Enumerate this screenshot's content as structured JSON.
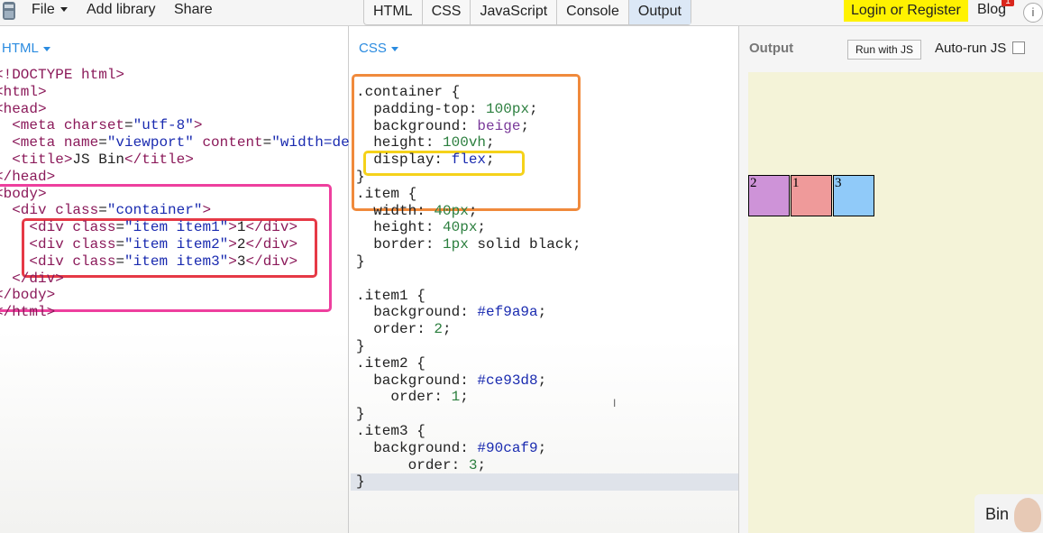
{
  "menu": {
    "file": "File",
    "add_library": "Add library",
    "share": "Share"
  },
  "tabs": [
    "HTML",
    "CSS",
    "JavaScript",
    "Console",
    "Output"
  ],
  "active_tab": "Output",
  "account": {
    "login": "Login or Register",
    "blog": "Blog",
    "badge": "1",
    "info": "i"
  },
  "html_panel": {
    "label": "HTML"
  },
  "css_panel": {
    "label": "CSS"
  },
  "output_panel": {
    "label": "Output",
    "run_button": "Run with JS",
    "autorun": "Auto-run JS",
    "autorun_checked": false
  },
  "html_code": {
    "l1": "<!DOCTYPE html>",
    "l2": "<html>",
    "l3": "<head>",
    "l4a": "  <meta ",
    "l4b": "charset",
    "l4c": "=",
    "l4d": "\"utf-8\"",
    "l4e": ">",
    "l5a": "  <meta ",
    "l5b": "name",
    "l5c": "=",
    "l5d": "\"viewport\"",
    "l5e": " content",
    "l5f": "=",
    "l5g": "\"width=de",
    "l6a": "  <title>",
    "l6b": "JS Bin",
    "l6c": "</title>",
    "l7": "</head>",
    "l8": "<body>",
    "l9a": "  <div ",
    "l9b": "class",
    "l9c": "=",
    "l9d": "\"container\"",
    "l9e": ">",
    "l10a": "    <div ",
    "l10b": "class",
    "l10c": "=",
    "l10d": "\"item item1\"",
    "l10e": ">",
    "l10f": "1",
    "l10g": "</div>",
    "l11a": "    <div ",
    "l11b": "class",
    "l11c": "=",
    "l11d": "\"item item2\"",
    "l11e": ">",
    "l11f": "2",
    "l11g": "</div>",
    "l12a": "    <div ",
    "l12b": "class",
    "l12c": "=",
    "l12d": "\"item item3\"",
    "l12e": ">",
    "l12f": "3",
    "l12g": "</div>",
    "l13": "  </div>",
    "l14": "</body>",
    "l15": "</html>"
  },
  "css_code": {
    "c1": ".container {",
    "c2a": "  padding-top: ",
    "c2b": "100px",
    "c2c": ";",
    "c3a": "  background: ",
    "c3b": "beige",
    "c3c": ";",
    "c4a": "  height: ",
    "c4b": "100vh",
    "c4c": ";",
    "c5a": "  display: ",
    "c5b": "flex",
    "c5c": ";",
    "c6": "}",
    "c7": ".item {",
    "c8a": "  width: ",
    "c8b": "40px",
    "c8c": ";",
    "c9a": "  height: ",
    "c9b": "40px",
    "c9c": ";",
    "c10a": "  border: ",
    "c10b": "1px",
    "c10c": " solid black;",
    "c11": "}",
    "c12": "",
    "c13": ".item1 {",
    "c14a": "  background: ",
    "c14b": "#ef9a9a",
    "c14c": ";",
    "c15a": "  order: ",
    "c15b": "2",
    "c15c": ";",
    "c16": "}",
    "c17": ".item2 {",
    "c18a": "  background: ",
    "c18b": "#ce93d8",
    "c18c": ";",
    "c19a": "    order: ",
    "c19b": "1",
    "c19c": ";",
    "c20": "}",
    "c21": ".item3 {",
    "c22a": "  background: ",
    "c22b": "#90caf9",
    "c22c": ";",
    "c23a": "      order: ",
    "c23b": "3",
    "c23c": ";",
    "c24": "}"
  },
  "output_items": [
    {
      "label": "2",
      "color": "#ce93d8"
    },
    {
      "label": "1",
      "color": "#ef9a9a"
    },
    {
      "label": "3",
      "color": "#90caf9"
    }
  ],
  "pip": {
    "text": "Bin"
  },
  "colors": {
    "highlight_pink": "#ee3f9e",
    "highlight_red": "#e63946",
    "highlight_orange": "#f08a3c",
    "highlight_yellow": "#f5d21a",
    "tab_active": "#dce8f6",
    "login_bg": "#fff200"
  }
}
